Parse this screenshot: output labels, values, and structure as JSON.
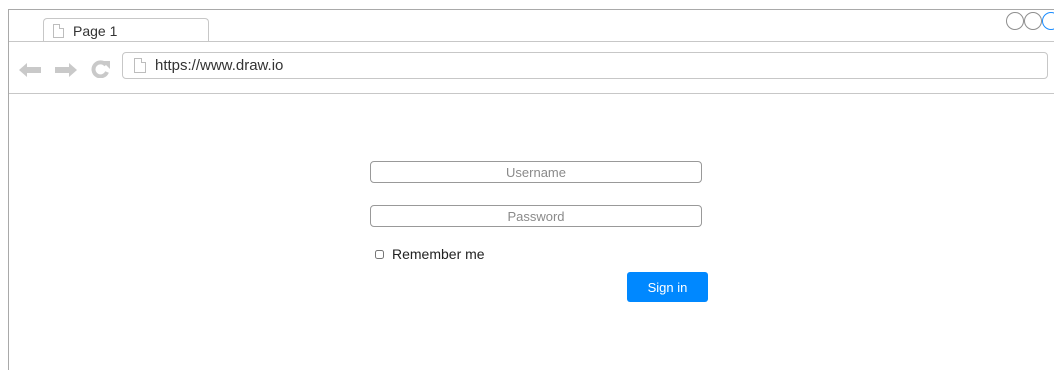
{
  "tab": {
    "label": "Page 1"
  },
  "address_bar": {
    "url": "https://www.draw.io"
  },
  "login_form": {
    "username_placeholder": "Username",
    "password_placeholder": "Password",
    "remember_label": "Remember me",
    "signin_label": "Sign in"
  },
  "icons": {
    "back": "back-arrow-icon",
    "forward": "forward-arrow-icon",
    "reload": "reload-icon",
    "page": "page-icon"
  },
  "colors": {
    "accent": "#0088ff",
    "window_control_active": "#1a8cff",
    "border": "#c7c7c7"
  }
}
